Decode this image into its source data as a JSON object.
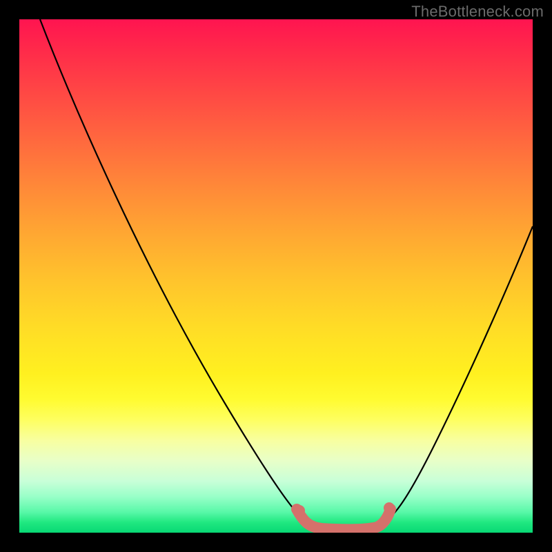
{
  "watermark": "TheBottleneck.com",
  "chart_data": {
    "type": "line",
    "title": "",
    "xlabel": "",
    "ylabel": "",
    "xlim": [
      0,
      100
    ],
    "ylim": [
      0,
      100
    ],
    "grid": false,
    "legend": false,
    "background_gradient": {
      "direction": "vertical",
      "stops": [
        {
          "pos": 0.0,
          "color": "#ff1450"
        },
        {
          "pos": 0.5,
          "color": "#ffc42c"
        },
        {
          "pos": 0.78,
          "color": "#feff60"
        },
        {
          "pos": 1.0,
          "color": "#08d874"
        }
      ]
    },
    "series": [
      {
        "name": "bottleneck-curve",
        "color": "#000000",
        "x": [
          4,
          10,
          20,
          30,
          40,
          50,
          55,
          57,
          60,
          65,
          70,
          72,
          75,
          80,
          85,
          90,
          95,
          100
        ],
        "values": [
          100,
          89,
          71,
          52,
          34,
          16,
          6,
          3,
          1,
          1,
          1,
          3,
          7,
          15,
          25,
          36,
          48,
          60
        ]
      },
      {
        "name": "optimal-band-marker",
        "color": "#d4716b",
        "style": "thick-rounded",
        "x": [
          55,
          57,
          60,
          63,
          66,
          69,
          71,
          72
        ],
        "values": [
          4,
          2,
          1,
          1,
          1,
          1,
          2,
          4
        ]
      }
    ],
    "annotations": []
  }
}
